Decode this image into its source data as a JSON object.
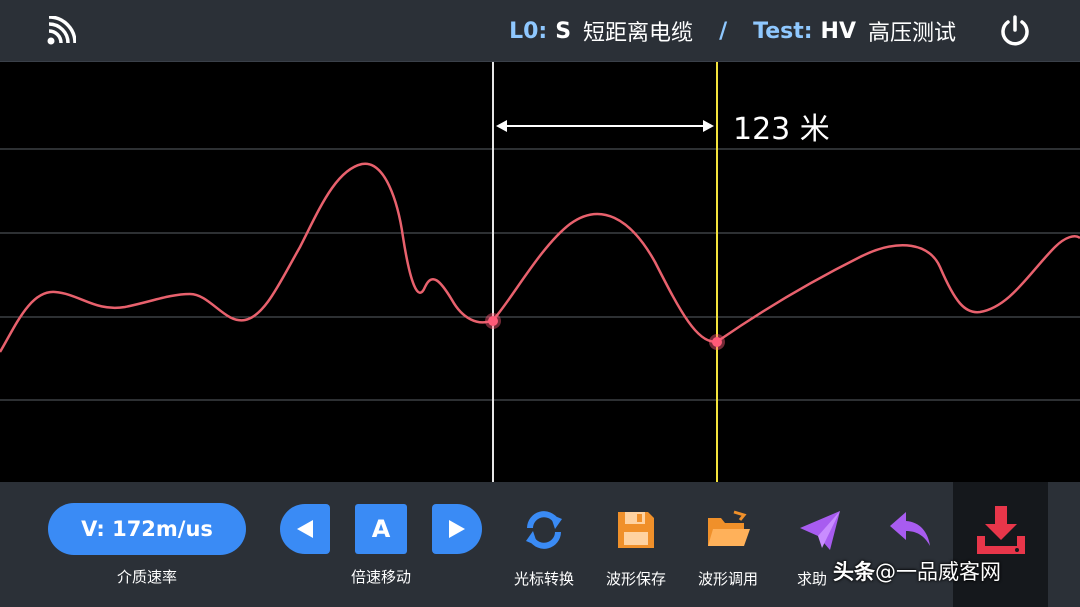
{
  "header": {
    "line_key": "L0:",
    "line_value": "S",
    "line_desc": "短距离电缆",
    "separator": "/",
    "test_key": "Test:",
    "test_value": "HV",
    "test_desc": "高压测试"
  },
  "plot": {
    "distance_label": "123 米",
    "colors": {
      "trace": "#e8616d",
      "cursor_a": "#e6e6e6",
      "cursor_b": "#f3e33c",
      "marker": "#ff5a78"
    }
  },
  "toolbar": {
    "velocity_value": "V:  172m/us",
    "velocity_caption": "介质速率",
    "cursor_letter": "A",
    "move_caption": "倍速移动",
    "tools": [
      {
        "label": "光标转换",
        "icon": "swap-cursor-icon",
        "color": "#3a8bf5"
      },
      {
        "label": "波形保存",
        "icon": "floppy-save-icon",
        "color": "#f0902a"
      },
      {
        "label": "波形调用",
        "icon": "folder-open-icon",
        "color": "#f0902a"
      },
      {
        "label": "求助",
        "icon": "paper-plane-icon",
        "color": "#a85cf0"
      },
      {
        "label": "",
        "icon": "back-arrow-icon",
        "color": "#a85cf0"
      },
      {
        "label": "",
        "icon": "download-icon",
        "color": "#e8364a"
      }
    ]
  },
  "watermark": {
    "brand": "头条",
    "handle": "@一品威客网"
  }
}
